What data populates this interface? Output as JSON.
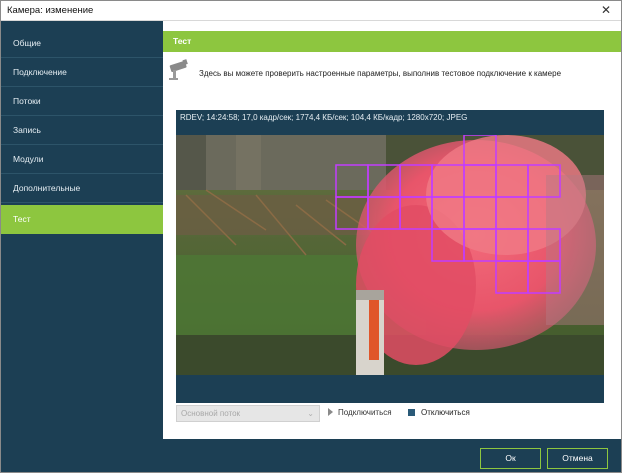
{
  "window": {
    "title": "Камера: изменение",
    "close_glyph": "✕"
  },
  "sidebar": {
    "items": [
      {
        "label": "Общие"
      },
      {
        "label": "Подключение"
      },
      {
        "label": "Потоки"
      },
      {
        "label": "Запись"
      },
      {
        "label": "Модули"
      },
      {
        "label": "Дополнительные"
      },
      {
        "label": "Тест",
        "active": true
      }
    ]
  },
  "section": {
    "title": "Тест",
    "info_text": "Здесь вы можете проверить настроенные параметры, выполнив тестовое подключение к камере",
    "icon": "camera-icon"
  },
  "preview": {
    "status": "RDEV; 14:24:58; 17,0 кадр/сек; 1774,4 КБ/сек; 104,4 КБ/кадр; 1280x720; JPEG"
  },
  "controls": {
    "stream_value": "Основной поток",
    "connect_label": "Подключиться",
    "disconnect_label": "Отключиться"
  },
  "footer": {
    "ok_label": "Ок",
    "cancel_label": "Отмена"
  },
  "colors": {
    "accent": "#8dc63f",
    "sidebar_bg": "#1c3f54",
    "motion_grid": "#c23cff"
  }
}
